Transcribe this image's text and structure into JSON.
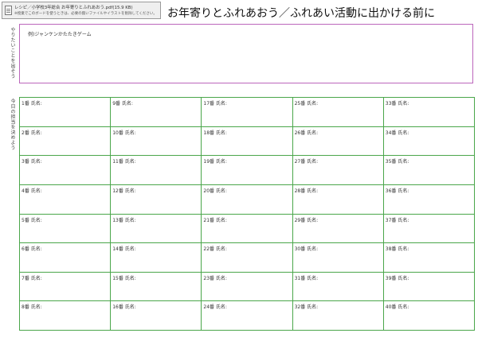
{
  "file": {
    "link_text": "レシピ／小学校3年総合 お年寄りとふれあおう.pdf(15.9 KB)",
    "note": "※授業でこのボードを使うときは、必要の無いファイルやイラストを削除してください。",
    "icon": "document-icon"
  },
  "title": "お年寄りとふれあおう／ふれあい活動に出かける前に",
  "side_labels": {
    "top": "やりたいことを出そう",
    "bottom": "今日の担当を決めよう"
  },
  "top_box": {
    "text": "例)ジャンケンかたたきゲーム"
  },
  "grid": {
    "cells": [
      "1番 氏名:",
      "2番 氏名:",
      "3番 氏名:",
      "4番 氏名:",
      "5番 氏名:",
      "6番 氏名:",
      "7番 氏名:",
      "8番 氏名:",
      "9番 氏名:",
      "10番 氏名:",
      "11番 氏名:",
      "12番 氏名:",
      "13番 氏名:",
      "14番 氏名:",
      "15番 氏名:",
      "16番 氏名:",
      "17番 氏名:",
      "18番 氏名:",
      "19番 氏名:",
      "20番 氏名:",
      "21番 氏名:",
      "22番 氏名:",
      "23番 氏名:",
      "24番 氏名:",
      "25番 氏名:",
      "26番 氏名:",
      "27番 氏名:",
      "28番 氏名:",
      "29番 氏名:",
      "30番 氏名:",
      "31番 氏名:",
      "32番 氏名:",
      "33番 氏名:",
      "34番 氏名:",
      "35番 氏名:",
      "36番 氏名:",
      "37番 氏名:",
      "38番 氏名:",
      "39番 氏名:",
      "40番 氏名:"
    ]
  },
  "colors": {
    "top_box_border": "#bb66bb",
    "grid_border": "#4aa64a"
  }
}
